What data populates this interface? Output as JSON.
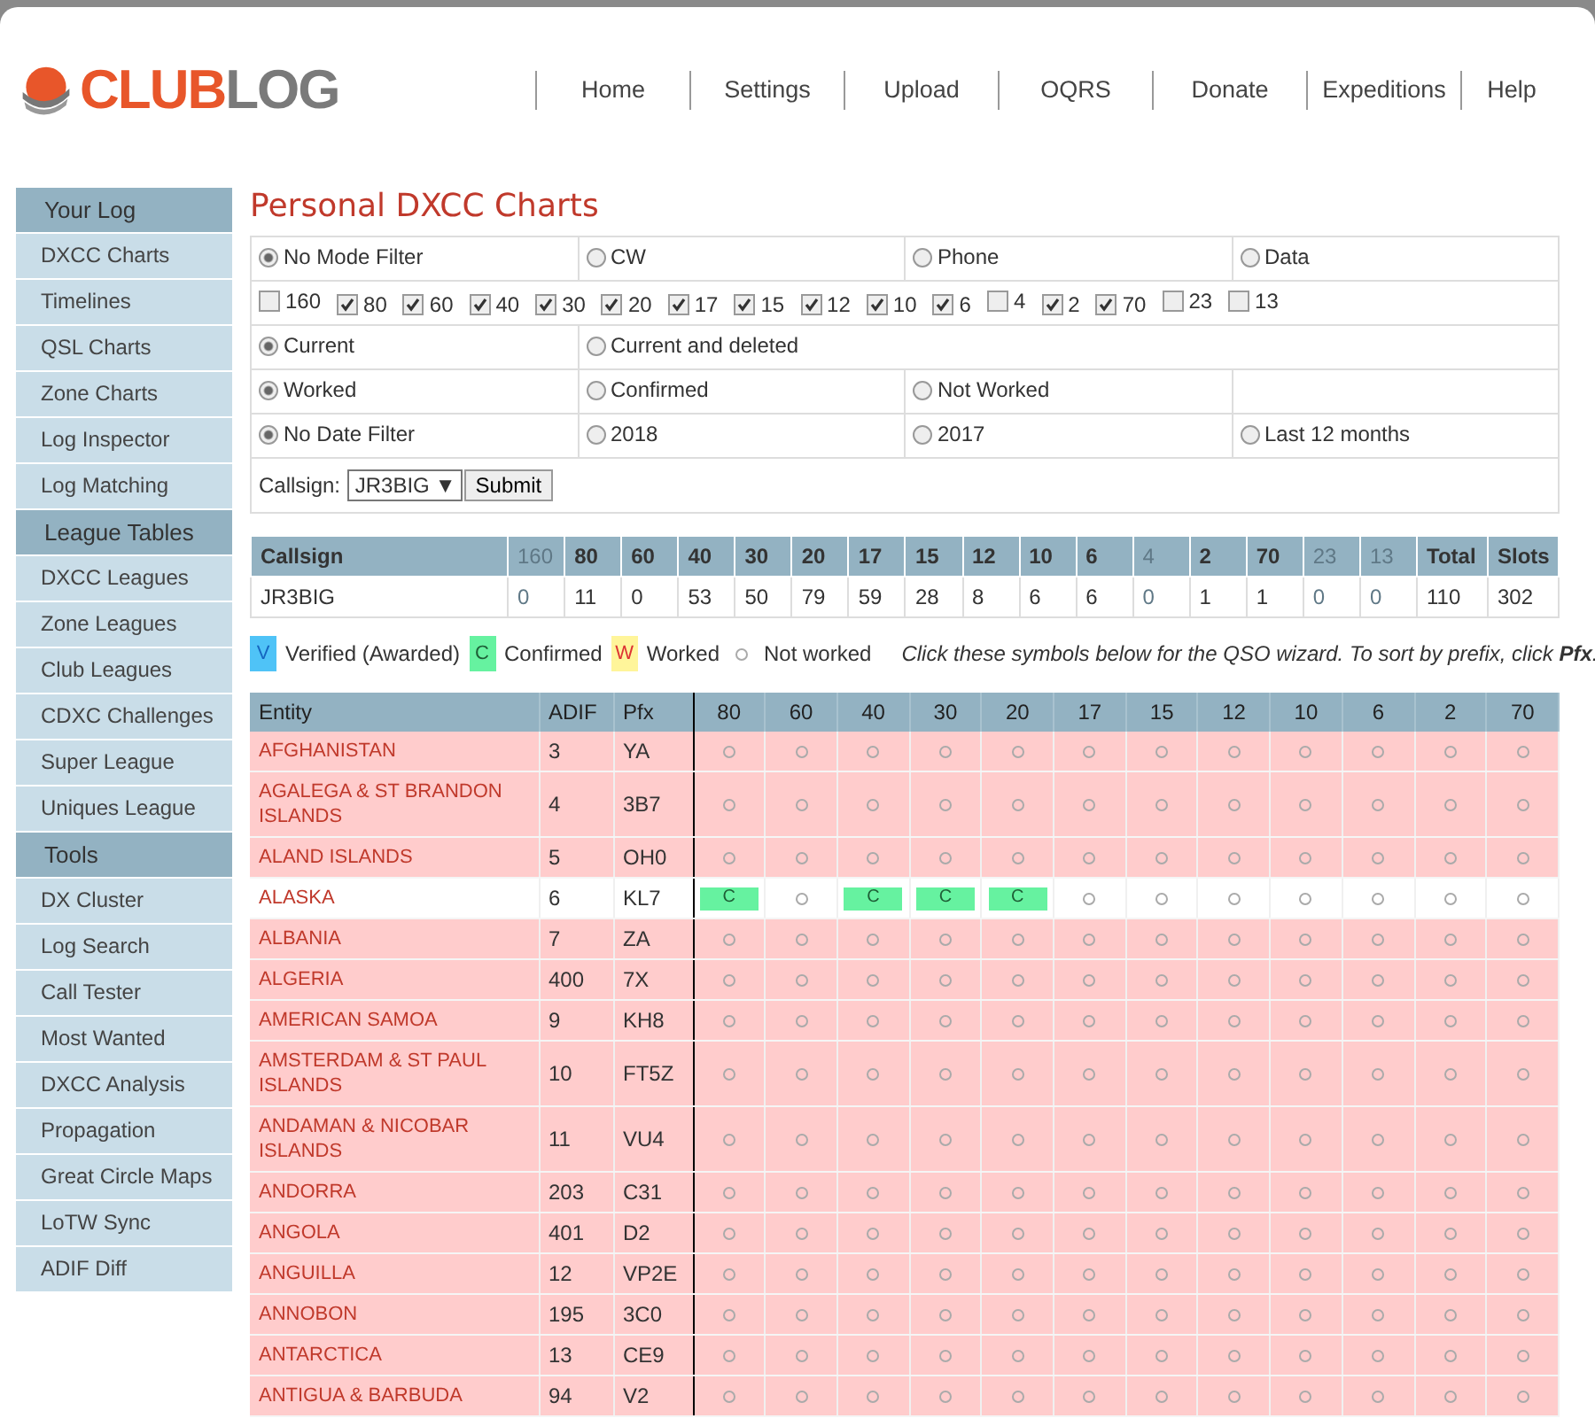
{
  "logo": {
    "part_1": "CLUB",
    "part_2": "LOG"
  },
  "nav": [
    "Home",
    "Settings",
    "Upload",
    "OQRS",
    "Donate",
    "Expeditions",
    "Help"
  ],
  "sidebar": [
    {
      "title": "Your Log",
      "items": [
        "DXCC Charts",
        "Timelines",
        "QSL Charts",
        "Zone Charts",
        "Log Inspector",
        "Log Matching"
      ]
    },
    {
      "title": "League Tables",
      "items": [
        "DXCC Leagues",
        "Zone Leagues",
        "Club Leagues",
        "CDXC Challenges",
        "Super League",
        "Uniques League"
      ]
    },
    {
      "title": "Tools",
      "items": [
        "DX Cluster",
        "Log Search",
        "Call Tester",
        "Most Wanted",
        "DXCC Analysis",
        "Propagation",
        "Great Circle Maps",
        "LoTW Sync",
        "ADIF Diff"
      ]
    }
  ],
  "page_title": "Personal DXCC Charts",
  "filters": {
    "mode": [
      {
        "label": "No Mode Filter",
        "selected": true
      },
      {
        "label": "CW",
        "selected": false
      },
      {
        "label": "Phone",
        "selected": false
      },
      {
        "label": "Data",
        "selected": false
      }
    ],
    "bands": [
      {
        "label": "160",
        "checked": false
      },
      {
        "label": "80",
        "checked": true
      },
      {
        "label": "60",
        "checked": true
      },
      {
        "label": "40",
        "checked": true
      },
      {
        "label": "30",
        "checked": true
      },
      {
        "label": "20",
        "checked": true
      },
      {
        "label": "17",
        "checked": true
      },
      {
        "label": "15",
        "checked": true
      },
      {
        "label": "12",
        "checked": true
      },
      {
        "label": "10",
        "checked": true
      },
      {
        "label": "6",
        "checked": true
      },
      {
        "label": "4",
        "checked": false
      },
      {
        "label": "2",
        "checked": true
      },
      {
        "label": "70",
        "checked": true
      },
      {
        "label": "23",
        "checked": false
      },
      {
        "label": "13",
        "checked": false
      }
    ],
    "log": [
      {
        "label": "Current",
        "selected": true
      },
      {
        "label": "Current and deleted",
        "selected": false
      }
    ],
    "status": [
      {
        "label": "Worked",
        "selected": true
      },
      {
        "label": "Confirmed",
        "selected": false
      },
      {
        "label": "Not Worked",
        "selected": false
      }
    ],
    "date": [
      {
        "label": "No Date Filter",
        "selected": true
      },
      {
        "label": "2018",
        "selected": false
      },
      {
        "label": "2017",
        "selected": false
      },
      {
        "label": "Last 12 months",
        "selected": false
      }
    ],
    "callsign_label": "Callsign:",
    "callsign_value": "JR3BIG",
    "callsign_arrow": "▼",
    "submit": "Submit"
  },
  "summary": {
    "callsign_header": "Callsign",
    "callsign": "JR3BIG",
    "columns": [
      {
        "label": "160",
        "disabled": true,
        "value": "0"
      },
      {
        "label": "80",
        "disabled": false,
        "value": "11"
      },
      {
        "label": "60",
        "disabled": false,
        "value": "0"
      },
      {
        "label": "40",
        "disabled": false,
        "value": "53"
      },
      {
        "label": "30",
        "disabled": false,
        "value": "50"
      },
      {
        "label": "20",
        "disabled": false,
        "value": "79"
      },
      {
        "label": "17",
        "disabled": false,
        "value": "59"
      },
      {
        "label": "15",
        "disabled": false,
        "value": "28"
      },
      {
        "label": "12",
        "disabled": false,
        "value": "8"
      },
      {
        "label": "10",
        "disabled": false,
        "value": "6"
      },
      {
        "label": "6",
        "disabled": false,
        "value": "6"
      },
      {
        "label": "4",
        "disabled": true,
        "value": "0"
      },
      {
        "label": "2",
        "disabled": false,
        "value": "1"
      },
      {
        "label": "70",
        "disabled": false,
        "value": "1"
      },
      {
        "label": "23",
        "disabled": true,
        "value": "0"
      },
      {
        "label": "13",
        "disabled": true,
        "value": "0"
      },
      {
        "label": "Total",
        "disabled": false,
        "value": "110"
      },
      {
        "label": "Slots",
        "disabled": false,
        "value": "302"
      }
    ]
  },
  "legend": [
    {
      "kind": "verified",
      "symbol": "V",
      "label": "Verified (Awarded)"
    },
    {
      "kind": "confirmed",
      "symbol": "C",
      "label": "Confirmed"
    },
    {
      "kind": "worked",
      "symbol": "W",
      "label": "Worked"
    },
    {
      "kind": "none",
      "label": "Not worked"
    }
  ],
  "legend_note": "Click these symbols below for the QSO wizard. To sort by prefix, click **Pfx**.",
  "chart": {
    "fixed_columns": [
      "Entity",
      "ADIF",
      "Pfx"
    ],
    "band_columns": [
      "80",
      "60",
      "40",
      "30",
      "20",
      "17",
      "15",
      "12",
      "10",
      "6",
      "2",
      "70"
    ],
    "rows": [
      {
        "entity": "AFGHANISTAN",
        "adif": "3",
        "pfx": "YA",
        "cells": [
          {
            "kind": "none"
          },
          {
            "kind": "none"
          },
          {
            "kind": "none"
          },
          {
            "kind": "none"
          },
          {
            "kind": "none"
          },
          {
            "kind": "none"
          },
          {
            "kind": "none"
          },
          {
            "kind": "none"
          },
          {
            "kind": "none"
          },
          {
            "kind": "none"
          },
          {
            "kind": "none"
          },
          {
            "kind": "none"
          }
        ]
      },
      {
        "entity": "AGALEGA & ST BRANDON ISLANDS",
        "adif": "4",
        "pfx": "3B7",
        "cells": [
          {
            "kind": "none"
          },
          {
            "kind": "none"
          },
          {
            "kind": "none"
          },
          {
            "kind": "none"
          },
          {
            "kind": "none"
          },
          {
            "kind": "none"
          },
          {
            "kind": "none"
          },
          {
            "kind": "none"
          },
          {
            "kind": "none"
          },
          {
            "kind": "none"
          },
          {
            "kind": "none"
          },
          {
            "kind": "none"
          }
        ]
      },
      {
        "entity": "ALAND ISLANDS",
        "adif": "5",
        "pfx": "OH0",
        "cells": [
          {
            "kind": "none"
          },
          {
            "kind": "none"
          },
          {
            "kind": "none"
          },
          {
            "kind": "none"
          },
          {
            "kind": "none"
          },
          {
            "kind": "none"
          },
          {
            "kind": "none"
          },
          {
            "kind": "none"
          },
          {
            "kind": "none"
          },
          {
            "kind": "none"
          },
          {
            "kind": "none"
          },
          {
            "kind": "none"
          }
        ]
      },
      {
        "entity": "ALASKA",
        "adif": "6",
        "pfx": "KL7",
        "cells": [
          {
            "kind": "confirmed",
            "symbol": "C"
          },
          {
            "kind": "none"
          },
          {
            "kind": "confirmed",
            "symbol": "C"
          },
          {
            "kind": "confirmed",
            "symbol": "C"
          },
          {
            "kind": "confirmed",
            "symbol": "C"
          },
          {
            "kind": "none"
          },
          {
            "kind": "none"
          },
          {
            "kind": "none"
          },
          {
            "kind": "none"
          },
          {
            "kind": "none"
          },
          {
            "kind": "none"
          },
          {
            "kind": "none"
          }
        ]
      },
      {
        "entity": "ALBANIA",
        "adif": "7",
        "pfx": "ZA",
        "cells": [
          {
            "kind": "none"
          },
          {
            "kind": "none"
          },
          {
            "kind": "none"
          },
          {
            "kind": "none"
          },
          {
            "kind": "none"
          },
          {
            "kind": "none"
          },
          {
            "kind": "none"
          },
          {
            "kind": "none"
          },
          {
            "kind": "none"
          },
          {
            "kind": "none"
          },
          {
            "kind": "none"
          },
          {
            "kind": "none"
          }
        ]
      },
      {
        "entity": "ALGERIA",
        "adif": "400",
        "pfx": "7X",
        "cells": [
          {
            "kind": "none"
          },
          {
            "kind": "none"
          },
          {
            "kind": "none"
          },
          {
            "kind": "none"
          },
          {
            "kind": "none"
          },
          {
            "kind": "none"
          },
          {
            "kind": "none"
          },
          {
            "kind": "none"
          },
          {
            "kind": "none"
          },
          {
            "kind": "none"
          },
          {
            "kind": "none"
          },
          {
            "kind": "none"
          }
        ]
      },
      {
        "entity": "AMERICAN SAMOA",
        "adif": "9",
        "pfx": "KH8",
        "cells": [
          {
            "kind": "none"
          },
          {
            "kind": "none"
          },
          {
            "kind": "none"
          },
          {
            "kind": "none"
          },
          {
            "kind": "none"
          },
          {
            "kind": "none"
          },
          {
            "kind": "none"
          },
          {
            "kind": "none"
          },
          {
            "kind": "none"
          },
          {
            "kind": "none"
          },
          {
            "kind": "none"
          },
          {
            "kind": "none"
          }
        ]
      },
      {
        "entity": "AMSTERDAM & ST PAUL ISLANDS",
        "adif": "10",
        "pfx": "FT5Z",
        "cells": [
          {
            "kind": "none"
          },
          {
            "kind": "none"
          },
          {
            "kind": "none"
          },
          {
            "kind": "none"
          },
          {
            "kind": "none"
          },
          {
            "kind": "none"
          },
          {
            "kind": "none"
          },
          {
            "kind": "none"
          },
          {
            "kind": "none"
          },
          {
            "kind": "none"
          },
          {
            "kind": "none"
          },
          {
            "kind": "none"
          }
        ]
      },
      {
        "entity": "ANDAMAN & NICOBAR ISLANDS",
        "adif": "11",
        "pfx": "VU4",
        "cells": [
          {
            "kind": "none"
          },
          {
            "kind": "none"
          },
          {
            "kind": "none"
          },
          {
            "kind": "none"
          },
          {
            "kind": "none"
          },
          {
            "kind": "none"
          },
          {
            "kind": "none"
          },
          {
            "kind": "none"
          },
          {
            "kind": "none"
          },
          {
            "kind": "none"
          },
          {
            "kind": "none"
          },
          {
            "kind": "none"
          }
        ]
      },
      {
        "entity": "ANDORRA",
        "adif": "203",
        "pfx": "C31",
        "cells": [
          {
            "kind": "none"
          },
          {
            "kind": "none"
          },
          {
            "kind": "none"
          },
          {
            "kind": "none"
          },
          {
            "kind": "none"
          },
          {
            "kind": "none"
          },
          {
            "kind": "none"
          },
          {
            "kind": "none"
          },
          {
            "kind": "none"
          },
          {
            "kind": "none"
          },
          {
            "kind": "none"
          },
          {
            "kind": "none"
          }
        ]
      },
      {
        "entity": "ANGOLA",
        "adif": "401",
        "pfx": "D2",
        "cells": [
          {
            "kind": "none"
          },
          {
            "kind": "none"
          },
          {
            "kind": "none"
          },
          {
            "kind": "none"
          },
          {
            "kind": "none"
          },
          {
            "kind": "none"
          },
          {
            "kind": "none"
          },
          {
            "kind": "none"
          },
          {
            "kind": "none"
          },
          {
            "kind": "none"
          },
          {
            "kind": "none"
          },
          {
            "kind": "none"
          }
        ]
      },
      {
        "entity": "ANGUILLA",
        "adif": "12",
        "pfx": "VP2E",
        "cells": [
          {
            "kind": "none"
          },
          {
            "kind": "none"
          },
          {
            "kind": "none"
          },
          {
            "kind": "none"
          },
          {
            "kind": "none"
          },
          {
            "kind": "none"
          },
          {
            "kind": "none"
          },
          {
            "kind": "none"
          },
          {
            "kind": "none"
          },
          {
            "kind": "none"
          },
          {
            "kind": "none"
          },
          {
            "kind": "none"
          }
        ]
      },
      {
        "entity": "ANNOBON",
        "adif": "195",
        "pfx": "3C0",
        "cells": [
          {
            "kind": "none"
          },
          {
            "kind": "none"
          },
          {
            "kind": "none"
          },
          {
            "kind": "none"
          },
          {
            "kind": "none"
          },
          {
            "kind": "none"
          },
          {
            "kind": "none"
          },
          {
            "kind": "none"
          },
          {
            "kind": "none"
          },
          {
            "kind": "none"
          },
          {
            "kind": "none"
          },
          {
            "kind": "none"
          }
        ]
      },
      {
        "entity": "ANTARCTICA",
        "adif": "13",
        "pfx": "CE9",
        "cells": [
          {
            "kind": "none"
          },
          {
            "kind": "none"
          },
          {
            "kind": "none"
          },
          {
            "kind": "none"
          },
          {
            "kind": "none"
          },
          {
            "kind": "none"
          },
          {
            "kind": "none"
          },
          {
            "kind": "none"
          },
          {
            "kind": "none"
          },
          {
            "kind": "none"
          },
          {
            "kind": "none"
          },
          {
            "kind": "none"
          }
        ]
      },
      {
        "entity": "ANTIGUA & BARBUDA",
        "adif": "94",
        "pfx": "V2",
        "cells": [
          {
            "kind": "none"
          },
          {
            "kind": "none"
          },
          {
            "kind": "none"
          },
          {
            "kind": "none"
          },
          {
            "kind": "none"
          },
          {
            "kind": "none"
          },
          {
            "kind": "none"
          },
          {
            "kind": "none"
          },
          {
            "kind": "none"
          },
          {
            "kind": "none"
          },
          {
            "kind": "none"
          },
          {
            "kind": "none"
          }
        ]
      }
    ]
  }
}
